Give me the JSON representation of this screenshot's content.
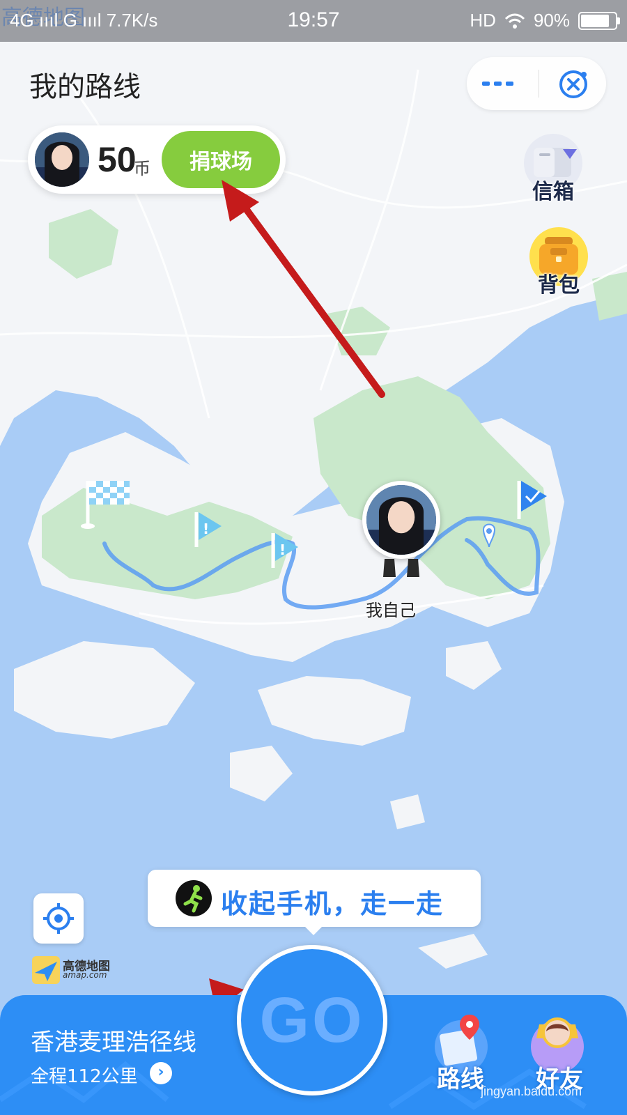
{
  "status_bar": {
    "watermark": "高德地图",
    "network": "4G ıııl G ıııl 7.7K/s",
    "time": "19:57",
    "hd": "HD",
    "battery_percent": "90%",
    "battery_level": 0.9
  },
  "header": {
    "title": "我的路线",
    "more_icon": "more-dots-icon",
    "close_icon": "close-circle-icon"
  },
  "coin_card": {
    "value": "50",
    "unit": "币",
    "donate_button": "捐球场"
  },
  "side_buttons": {
    "mailbox": "信箱",
    "backpack": "背包"
  },
  "map": {
    "me_label": "我自己",
    "accent": "#3f88f0",
    "route_color": "#5b9cf2",
    "land_color": "#f3f5f8",
    "park_color": "#c9e8cb",
    "water_color": "#a9ccf6"
  },
  "tip": {
    "text": "收起手机，走一走"
  },
  "amap_logo": {
    "name": "高德地图",
    "domain": "amap.com"
  },
  "bottom_bar": {
    "route_name": "香港麦理浩径线",
    "route_distance": "全程112公里",
    "go_label": "GO",
    "route_tab": "路线",
    "friends_tab": "好友",
    "watermark": "jingyan.baidu.com",
    "brand_color": "#2d8ef5"
  }
}
